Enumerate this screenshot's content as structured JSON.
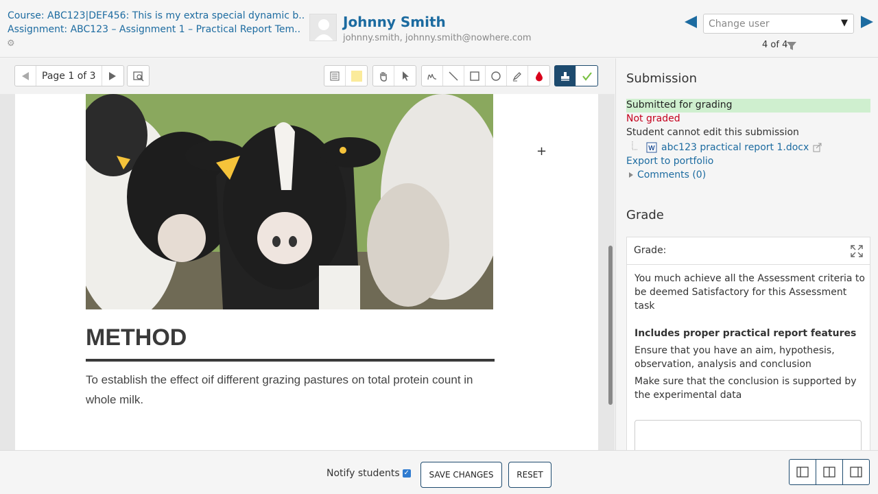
{
  "header": {
    "course": "Course: ABC123|DEF456: This is my extra special dynamic b..",
    "assignment": "Assignment: ABC123 – Assignment 1 – Practical Report Tem..",
    "user_name": "Johnny Smith",
    "user_email": "johnny.smith, johnny.smith@nowhere.com",
    "change_user_placeholder": "Change user",
    "user_count": "4 of 4"
  },
  "toolbar": {
    "page_label": "Page 1 of 3"
  },
  "document": {
    "heading": "METHOD",
    "text": "To establish the effect oif different grazing pastures on total protein count in whole milk."
  },
  "submission": {
    "heading": "Submission",
    "status": "Submitted for grading",
    "grading_status": "Not graded",
    "edit_status": "Student cannot edit this submission",
    "file_name": "abc123 practical report 1.docx",
    "export_link": "Export to portfolio",
    "comments_link": "Comments (0)"
  },
  "grade": {
    "heading": "Grade",
    "label": "Grade:",
    "intro": "You much achieve all the Assessment criteria to be deemed Satisfactory for this Assessment task",
    "criterion_title": "Includes proper practical report features",
    "criterion_1": "Ensure that you have an aim, hypothesis, observation, analysis and conclusion",
    "criterion_2": "Make sure that the conclusion is supported by the experimental data"
  },
  "footer": {
    "notify_label": "Notify students",
    "save_label": "SAVE CHANGES",
    "reset_label": "RESET"
  },
  "colors": {
    "link": "#1c6ba0",
    "submitted_bg": "#cfefcf",
    "not_graded": "#c4001d",
    "stamp_active": "#1d4a6e"
  }
}
